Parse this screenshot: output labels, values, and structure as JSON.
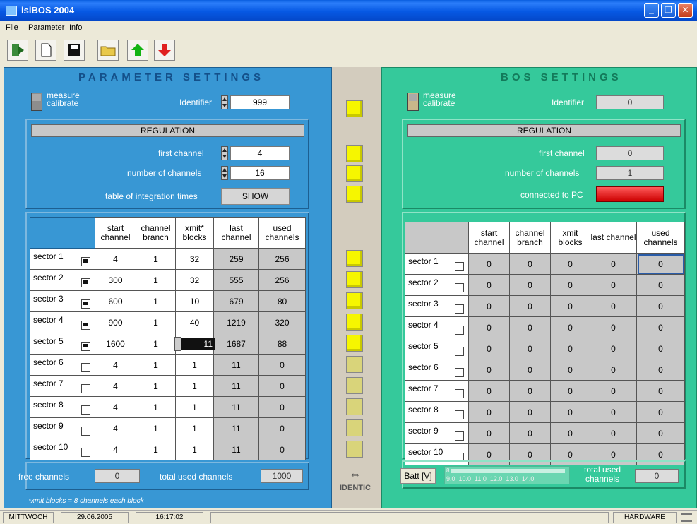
{
  "window": {
    "title": "isiBOS  2004"
  },
  "menu": {
    "file": "File",
    "parameter": "Parameter",
    "info": "Info"
  },
  "left": {
    "title": "PARAMETER   SETTINGS",
    "mode_top": "measure",
    "mode_bottom": "calibrate",
    "identifier_label": "Identifier",
    "identifier": "999",
    "regulation_title": "REGULATION",
    "first_channel_label": "first channel",
    "first_channel": "4",
    "num_channels_label": "number of channels",
    "num_channels": "16",
    "table_integration_label": "table of integration times",
    "show_button": "SHOW",
    "columns": [
      "start channel",
      "channel branch",
      "xmit* blocks",
      "last channel",
      "used channels"
    ],
    "rows": [
      {
        "name": "sector 1",
        "checked": true,
        "start": "4",
        "branch": "1",
        "xmit": "32",
        "last": "259",
        "used": "256"
      },
      {
        "name": "sector 2",
        "checked": true,
        "start": "300",
        "branch": "1",
        "xmit": "32",
        "last": "555",
        "used": "256"
      },
      {
        "name": "sector 3",
        "checked": true,
        "start": "600",
        "branch": "1",
        "xmit": "10",
        "last": "679",
        "used": "80"
      },
      {
        "name": "sector 4",
        "checked": true,
        "start": "900",
        "branch": "1",
        "xmit": "40",
        "last": "1219",
        "used": "320"
      },
      {
        "name": "sector 5",
        "checked": true,
        "start": "1600",
        "branch": "1",
        "xmit": "11",
        "last": "1687",
        "used": "88"
      },
      {
        "name": "sector 6",
        "checked": false,
        "start": "4",
        "branch": "1",
        "xmit": "1",
        "last": "11",
        "used": "0"
      },
      {
        "name": "sector 7",
        "checked": false,
        "start": "4",
        "branch": "1",
        "xmit": "1",
        "last": "11",
        "used": "0"
      },
      {
        "name": "sector 8",
        "checked": false,
        "start": "4",
        "branch": "1",
        "xmit": "1",
        "last": "11",
        "used": "0"
      },
      {
        "name": "sector 9",
        "checked": false,
        "start": "4",
        "branch": "1",
        "xmit": "1",
        "last": "11",
        "used": "0"
      },
      {
        "name": "sector 10",
        "checked": false,
        "start": "4",
        "branch": "1",
        "xmit": "1",
        "last": "11",
        "used": "0"
      }
    ],
    "free_channels_label": "free channels",
    "free_channels": "0",
    "total_used_label": "total used channels",
    "total_used": "1000",
    "footnote": "*xmit blocks = 8 channels each block"
  },
  "middle": {
    "identic_label": "IDENTIC",
    "indicators_top": [
      true,
      true,
      true,
      true
    ],
    "indicators_rows": [
      true,
      true,
      true,
      true,
      true,
      false,
      false,
      false,
      false,
      false
    ]
  },
  "right": {
    "title": "BOS   SETTINGS",
    "mode_top": "measure",
    "mode_bottom": "calibrate",
    "identifier_label": "Identifier",
    "identifier": "0",
    "regulation_title": "REGULATION",
    "first_channel_label": "first channel",
    "first_channel": "0",
    "num_channels_label": "number of channels",
    "num_channels": "1",
    "connected_label": "connected to PC",
    "connected_color": "#e01010",
    "columns": [
      "start channel",
      "channel branch",
      "xmit blocks",
      "last channel",
      "used channels"
    ],
    "rows": [
      {
        "name": "sector 1",
        "start": "0",
        "branch": "0",
        "xmit": "0",
        "last": "0",
        "used": "0"
      },
      {
        "name": "sector 2",
        "start": "0",
        "branch": "0",
        "xmit": "0",
        "last": "0",
        "used": "0"
      },
      {
        "name": "sector 3",
        "start": "0",
        "branch": "0",
        "xmit": "0",
        "last": "0",
        "used": "0"
      },
      {
        "name": "sector 4",
        "start": "0",
        "branch": "0",
        "xmit": "0",
        "last": "0",
        "used": "0"
      },
      {
        "name": "sector 5",
        "start": "0",
        "branch": "0",
        "xmit": "0",
        "last": "0",
        "used": "0"
      },
      {
        "name": "sector 6",
        "start": "0",
        "branch": "0",
        "xmit": "0",
        "last": "0",
        "used": "0"
      },
      {
        "name": "sector 7",
        "start": "0",
        "branch": "0",
        "xmit": "0",
        "last": "0",
        "used": "0"
      },
      {
        "name": "sector 8",
        "start": "0",
        "branch": "0",
        "xmit": "0",
        "last": "0",
        "used": "0"
      },
      {
        "name": "sector 9",
        "start": "0",
        "branch": "0",
        "xmit": "0",
        "last": "0",
        "used": "0"
      },
      {
        "name": "sector 10",
        "start": "0",
        "branch": "0",
        "xmit": "0",
        "last": "0",
        "used": "0"
      }
    ],
    "batt_label": "Batt [V]",
    "batt_scale": "9.0  10.0  11.0  12.0  13.0  14.0",
    "batt_marker": "8",
    "total_used_label_1": "total used",
    "total_used_label_2": "channels",
    "total_used": "0"
  },
  "status": {
    "day": "MITTWOCH",
    "date": "29.06.2005",
    "time": "16:17:02",
    "mode": "HARDWARE"
  },
  "colors": {
    "left_panel": "#3897d4",
    "right_panel": "#35c99b",
    "led_on": "#f6f600"
  }
}
